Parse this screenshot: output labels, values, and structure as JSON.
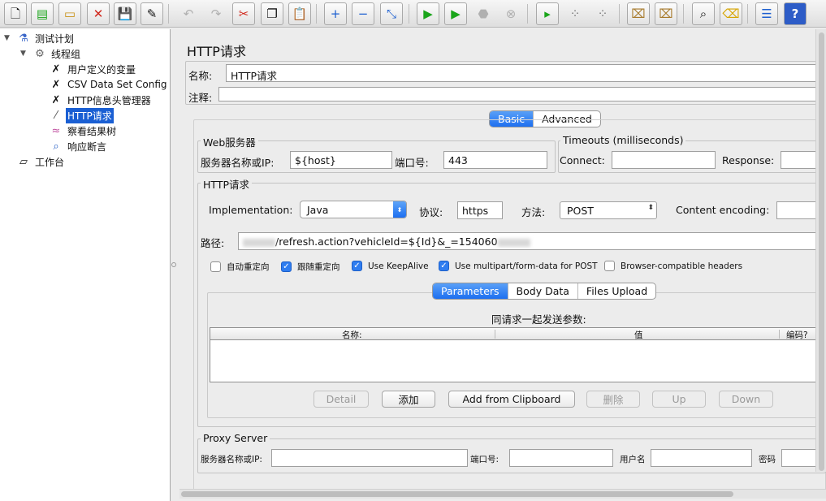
{
  "toolbar": {
    "icons": [
      "new-icon",
      "templates-icon",
      "open-icon",
      "close-icon",
      "save-icon",
      "save-as-icon",
      "undo-icon",
      "redo-icon",
      "cut-icon",
      "copy-icon",
      "paste-icon",
      "expand-icon",
      "collapse-icon",
      "toggle-icon",
      "start-icon",
      "start-no-pause-icon",
      "stop-icon",
      "shutdown-icon",
      "remote-start-icon",
      "remote-stop-icon",
      "remote-shutdown-icon",
      "clear-icon",
      "clear-all-icon",
      "search-icon",
      "reset-search-icon",
      "function-helper-icon",
      "help-icon"
    ]
  },
  "tree": {
    "items": [
      {
        "label": "测试计划",
        "icon": "flask-icon"
      },
      {
        "label": "线程组",
        "icon": "gear-icon"
      },
      {
        "label": "用户定义的变量",
        "icon": "wrench-icon"
      },
      {
        "label": "CSV Data Set Config",
        "icon": "wrench-icon"
      },
      {
        "label": "HTTP信息头管理器",
        "icon": "wrench-icon"
      },
      {
        "label": "HTTP请求",
        "icon": "pipette-icon"
      },
      {
        "label": "察看结果树",
        "icon": "chart-icon"
      },
      {
        "label": "响应断言",
        "icon": "magnifier-icon"
      },
      {
        "label": "工作台",
        "icon": "workbench-icon"
      }
    ]
  },
  "panel": {
    "title": "HTTP请求",
    "name_label": "名称:",
    "name_value": "HTTP请求",
    "comment_label": "注释:",
    "comment_value": "",
    "tabs": [
      "Basic",
      "Advanced"
    ],
    "web_server": {
      "legend": "Web服务器",
      "server_label": "服务器名称或IP:",
      "server_value": "${host}",
      "port_label": "端口号:",
      "port_value": "443"
    },
    "timeouts": {
      "legend": "Timeouts (milliseconds)",
      "connect_label": "Connect:",
      "connect_value": "",
      "response_label": "Response:",
      "response_value": ""
    },
    "http_request": {
      "legend": "HTTP请求",
      "implementation_label": "Implementation:",
      "implementation_value": "Java",
      "protocol_label": "协议:",
      "protocol_value": "https",
      "method_label": "方法:",
      "method_value": "POST",
      "encoding_label": "Content encoding:",
      "encoding_value": "",
      "path_label": "路径:",
      "path_value": "/refresh.action?vehicleId=${Id}&_=154060"
    },
    "checkboxes": [
      {
        "label": "自动重定向",
        "checked": false
      },
      {
        "label": "跟随重定向",
        "checked": true
      },
      {
        "label": "Use KeepAlive",
        "checked": true
      },
      {
        "label": "Use multipart/form-data for POST",
        "checked": true
      },
      {
        "label": "Browser-compatible headers",
        "checked": false
      }
    ],
    "param_tabs": [
      "Parameters",
      "Body Data",
      "Files Upload"
    ],
    "params_title": "同请求一起发送参数:",
    "columns": [
      "名称:",
      "值",
      "编码?"
    ],
    "buttons": [
      {
        "label": "Detail",
        "enabled": false
      },
      {
        "label": "添加",
        "enabled": true
      },
      {
        "label": "Add from Clipboard",
        "enabled": true
      },
      {
        "label": "删除",
        "enabled": false
      },
      {
        "label": "Up",
        "enabled": false
      },
      {
        "label": "Down",
        "enabled": false
      }
    ],
    "proxy": {
      "legend": "Proxy Server",
      "server_label": "服务器名称或IP:",
      "port_label": "端口号:",
      "user_label": "用户名",
      "password_label": "密码"
    }
  }
}
